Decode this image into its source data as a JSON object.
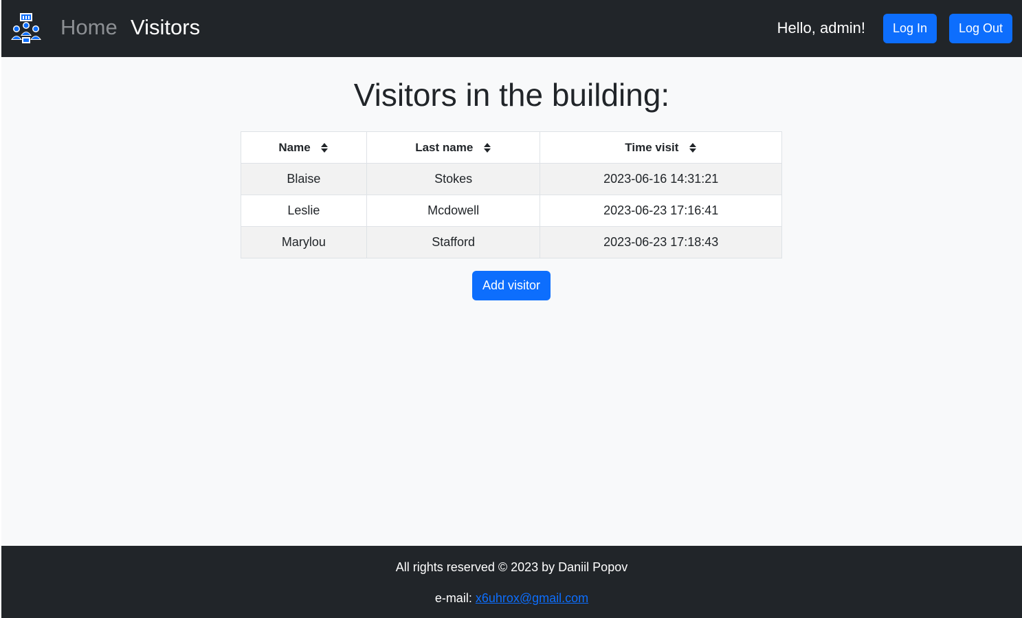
{
  "nav": {
    "home_label": "Home",
    "visitors_label": "Visitors",
    "greeting": "Hello, admin!",
    "login_label": "Log In",
    "logout_label": "Log Out",
    "logo_icon": "building-visitors-logo-icon"
  },
  "main": {
    "title": "Visitors in the building:",
    "table": {
      "headers": [
        "Name",
        "Last name",
        "Time visit"
      ],
      "sort_icon": "sort-arrows-icon",
      "rows": [
        [
          "Blaise",
          "Stokes",
          "2023-06-16 14:31:21"
        ],
        [
          "Leslie",
          "Mcdowell",
          "2023-06-23 17:16:41"
        ],
        [
          "Marylou",
          "Stafford",
          "2023-06-23 17:18:43"
        ]
      ]
    },
    "add_label": "Add visitor"
  },
  "footer": {
    "rights": "All rights reserved © 2023 by Daniil Popov",
    "email_prefix": "e-mail:",
    "email": "x6uhrox@gmail.com"
  },
  "colors": {
    "navbar_bg": "#212529",
    "page_bg": "#f8f9fa",
    "primary": "#0d6efd",
    "stripe": "#f2f2f2"
  }
}
